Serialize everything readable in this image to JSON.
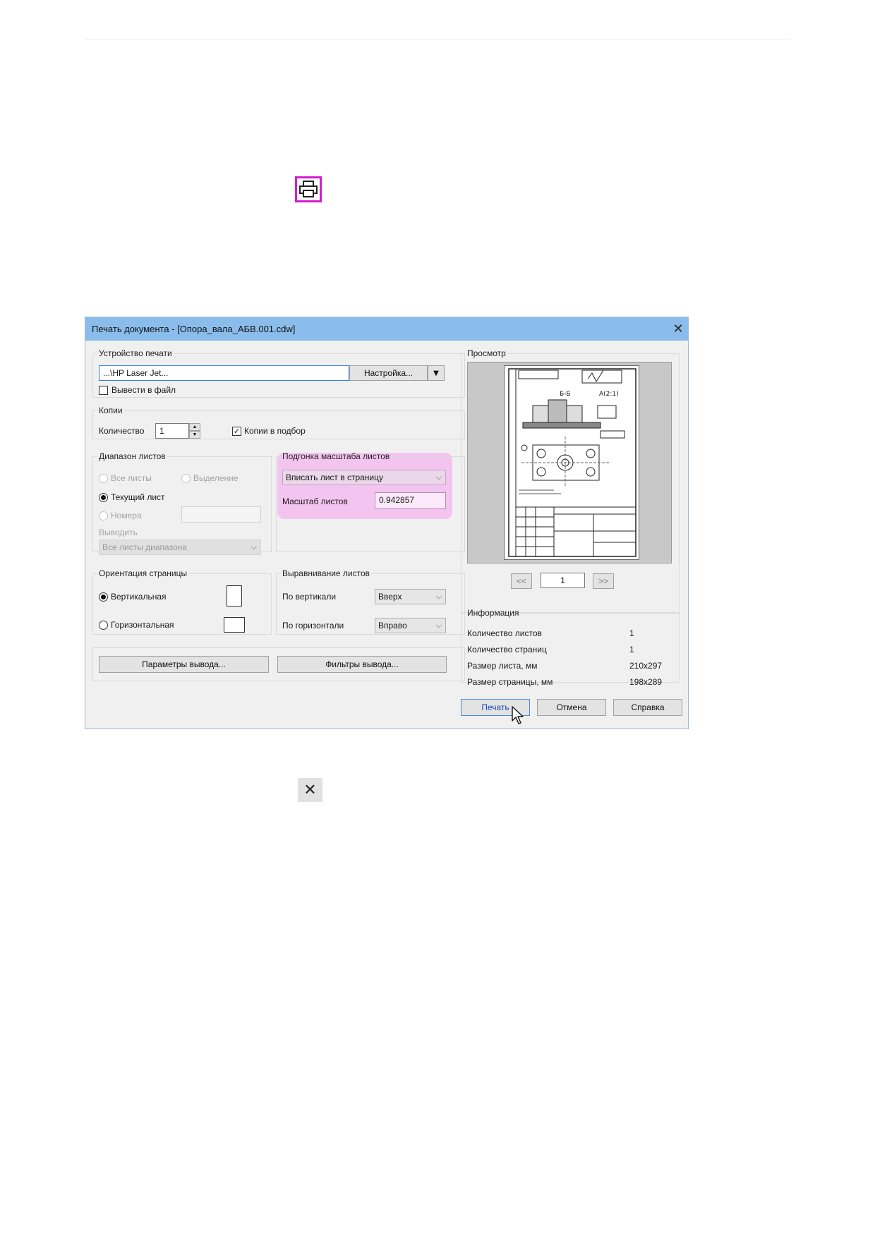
{
  "dialog": {
    "title": "Печать документа - [Опора_вала_АБВ.001.cdw]",
    "printer_group": {
      "legend": "Устройство печати",
      "printer_name": "...\\HP Laser Jet...",
      "setup_button": "Настройка...",
      "print_to_file": "Вывести в файл"
    },
    "copies_group": {
      "legend": "Копии",
      "count_label": "Количество",
      "count_value": "1",
      "collate_label": "Копии в подбор"
    },
    "range_group": {
      "legend": "Диапазон листов",
      "all_sheets": "Все листы",
      "selection": "Выделение",
      "current_sheet": "Текущий лист",
      "numbers": "Номера",
      "output_label": "Выводить",
      "output_value": "Все листы диапазона"
    },
    "scale_group": {
      "legend": "Подгонка масштаба листов",
      "mode_value": "Вписать лист в страницу",
      "scale_label": "Масштаб листов",
      "scale_value": "0.942857"
    },
    "orientation_group": {
      "legend": "Ориентация страницы",
      "portrait": "Вертикальная",
      "landscape": "Горизонтальная"
    },
    "align_group": {
      "legend": "Выравнивание листов",
      "vertical_label": "По вертикали",
      "vertical_value": "Вверх",
      "horizontal_label": "По горизонтали",
      "horizontal_value": "Вправо"
    },
    "output_params_button": "Параметры вывода...",
    "output_filters_button": "Фильтры вывода...",
    "preview": {
      "legend": "Просмотр",
      "prev": "<<",
      "page": "1",
      "next": ">>"
    },
    "info": {
      "legend": "Информация",
      "rows": [
        {
          "label": "Количество листов",
          "value": "1"
        },
        {
          "label": "Количество страниц",
          "value": "1"
        },
        {
          "label": "Размер листа, мм",
          "value": "210x297"
        },
        {
          "label": "Размер страницы, мм",
          "value": "198x289"
        }
      ]
    },
    "print_button": "Печать",
    "cancel_button": "Отмена",
    "help_button": "Справка"
  },
  "colors": {
    "titlebar": "#8bbdec",
    "highlight": "#f4c4f1",
    "icon_outline": "#d21bd2"
  },
  "icons": [
    "printer-icon",
    "close-icon",
    "cursor-icon"
  ]
}
